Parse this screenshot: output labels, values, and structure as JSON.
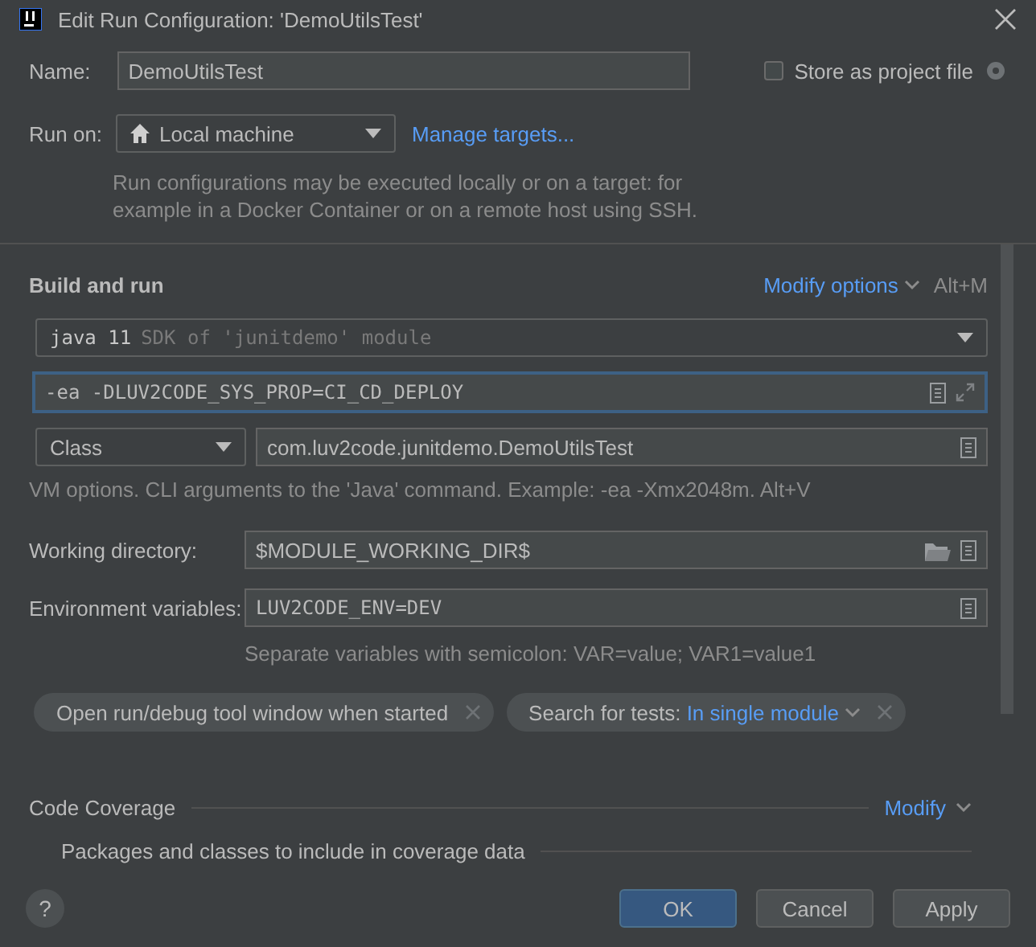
{
  "window": {
    "title": "Edit Run Configuration: 'DemoUtilsTest'"
  },
  "name": {
    "label": "Name:",
    "value": "DemoUtilsTest"
  },
  "store_as_project_file": {
    "label": "Store as project file",
    "checked": false
  },
  "run_on": {
    "label": "Run on:",
    "value": "Local machine",
    "link": "Manage targets...",
    "description": "Run configurations may be executed locally or on a target: for example in a Docker Container or on a remote host using SSH."
  },
  "build_and_run": {
    "title": "Build and run",
    "modify_options": "Modify options",
    "shortcut": "Alt+M",
    "jre_version": "java 11",
    "jre_detail": "SDK of 'junitdemo' module",
    "vm_options": "-ea -DLUV2CODE_SYS_PROP=CI_CD_DEPLOY",
    "test_kind": "Class",
    "test_class": "com.luv2code.junitdemo.DemoUtilsTest",
    "vm_hint": "VM options. CLI arguments to the 'Java' command. Example: -ea -Xmx2048m. Alt+V"
  },
  "working_directory": {
    "label": "Working directory:",
    "value": "$MODULE_WORKING_DIR$"
  },
  "environment_variables": {
    "label": "Environment variables:",
    "value": "LUV2CODE_ENV=DEV",
    "hint": "Separate variables with semicolon: VAR=value; VAR1=value1"
  },
  "options": [
    {
      "kind": "plain",
      "label": "Open run/debug tool window when started"
    },
    {
      "kind": "choice",
      "label": "Search for tests:",
      "value": "In single module"
    }
  ],
  "code_coverage": {
    "title": "Code Coverage",
    "modify": "Modify",
    "packages": "Packages and classes to include in coverage data"
  },
  "help": "?",
  "buttons": [
    {
      "label": "OK",
      "default": true
    },
    {
      "label": "Cancel",
      "default": false
    },
    {
      "label": "Apply",
      "default": false
    }
  ]
}
